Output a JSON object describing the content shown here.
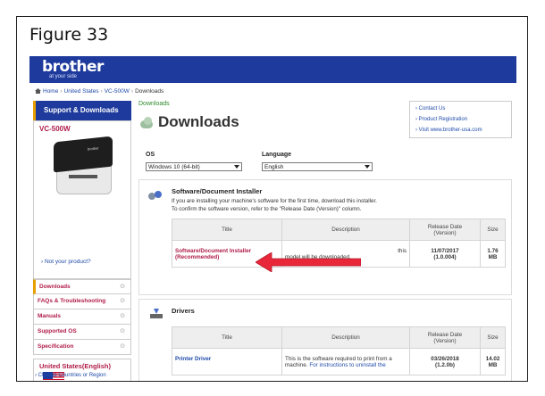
{
  "figure": {
    "title": "Figure 33"
  },
  "header": {
    "brand": "brother",
    "tagline": "at your side"
  },
  "breadcrumb": {
    "home": "Home",
    "country": "United States",
    "model": "VC-500W",
    "current": "Downloads"
  },
  "sidebar": {
    "title": "Support & Downloads",
    "model": "VC-500W",
    "printer_brand": "brother",
    "not_your_product": "Not your product?",
    "items": [
      {
        "label": "Downloads"
      },
      {
        "label": "FAQs & Troubleshooting"
      },
      {
        "label": "Manuals"
      },
      {
        "label": "Supported OS"
      },
      {
        "label": "Specification"
      }
    ],
    "expand_glyph": "⊙",
    "region_title": "United States(English)",
    "change_region": "Change Countries or Region"
  },
  "content": {
    "crumb": "Downloads",
    "title": "Downloads",
    "links": [
      "Contact Us",
      "Product Registration",
      "Visit www.brother-usa.com"
    ],
    "os_label": "OS",
    "os_value": "Windows 10 (64-bit)",
    "language_label": "Language",
    "language_value": "English"
  },
  "software_section": {
    "title": "Software/Document Installer",
    "desc1": "If you are installing your machine's software for the first time, download this installer.",
    "desc2": "To confirm the software version, refer to the \"Release Date (Version)\" column.",
    "headers": {
      "title": "Title",
      "description": "Description",
      "release_date": "Release Date",
      "version": "(Version)",
      "size": "Size"
    },
    "row": {
      "title": "Software/Document Installer",
      "recommended": "(Recommended)",
      "desc_tail": "this",
      "desc_line2": "model will be downloaded.",
      "date": "11/07/2017",
      "version": "(1.0.004)",
      "size1": "1.76",
      "size2": "MB"
    }
  },
  "drivers_section": {
    "title": "Drivers",
    "headers": {
      "title": "Title",
      "description": "Description",
      "release_date": "Release Date",
      "version": "(Version)",
      "size": "Size"
    },
    "row": {
      "title": "Printer Driver",
      "desc_line1": "This is the software required to print from a",
      "desc_line2_plain": "machine. ",
      "desc_line2_link": "For instructions to uninstall the",
      "date": "03/26/2018",
      "version": "(1.2.0b)",
      "size1": "14.02",
      "size2": "MB"
    }
  },
  "colors": {
    "brand_blue": "#1d3a9c",
    "accent_red": "#b01c4a",
    "link_blue": "#1f4aa8",
    "arrow_red": "#e8273a"
  }
}
